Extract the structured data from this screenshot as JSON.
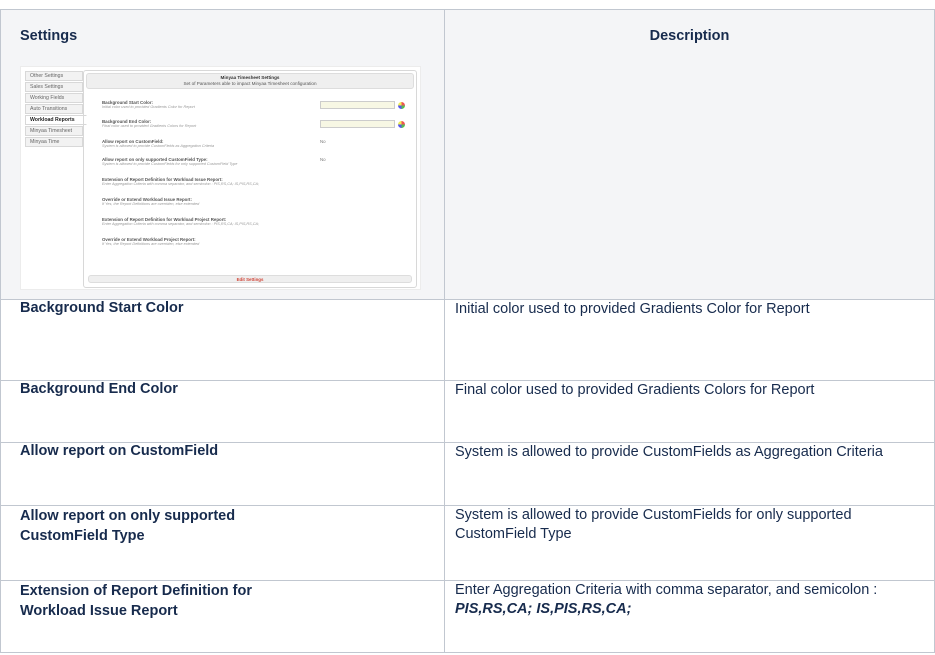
{
  "table": {
    "headers": {
      "settings": "Settings",
      "description": "Description"
    },
    "thumbnail": {
      "tabs": [
        "Other Settings",
        "Sales Settings",
        "Working Fields",
        "Auto Transitions",
        "Workload Reports",
        "Minyaa Timesheet",
        "Minyaa Time"
      ],
      "active_tab_index": 4,
      "panel_title": "Minyaa Timesheet Settings",
      "panel_subtitle": "Set of Parameters able to impact Minyaa Timesheet configuration",
      "rows": [
        {
          "label": "Background Start Color:",
          "desc": "Initial color used to provided Gradients Color for Report",
          "kind": "color"
        },
        {
          "label": "Background End Color:",
          "desc": "Final color used to provided Gradients Colors for Report",
          "kind": "color"
        },
        {
          "label": "Allow report on CustomField:",
          "desc": "System is allowed to provide CustomFields as Aggregation Criteria",
          "value": "No"
        },
        {
          "label": "Allow report on only supported CustomField Type:",
          "desc": "System is allowed to provide CustomFields for only supported CustomField Type",
          "value": "No"
        },
        {
          "label": "Extension of Report Definition for Workload Issue Report:",
          "desc": "Enter Aggregation Criteria with comma separator, and semicolon : PIS,RS,CA; IS,PIS,RS,CA;"
        },
        {
          "label": "Override or Extend Workload Issue Report:",
          "desc": "If Yes, the Report Definitions are overriden, else extended"
        },
        {
          "label": "Extension of Report Definition for Workload Project Report:",
          "desc": "Enter Aggregation Criteria with comma separator, and semicolon : PIS,RS,CA; IS,PIS,RS,CA;"
        },
        {
          "label": "Override or Extend Workload Project Report:",
          "desc": "If Yes, the Report Definitions are overriden, else extended"
        }
      ],
      "edit_button": "Edit Settings"
    },
    "rows": [
      {
        "name": "Background Start Color",
        "desc": "Initial color used to provided Gradients Color for Report"
      },
      {
        "name": "Background End Color",
        "desc": "Final color used to provided Gradients Colors for Report"
      },
      {
        "name": "Allow report on CustomField",
        "desc": "System is allowed to provide CustomFields as Aggregation Criteria"
      },
      {
        "name_line1": "Allow report on only supported",
        "name_line2": "CustomField Type",
        "desc": "System is allowed to provide CustomFields for only supported CustomField Type"
      },
      {
        "name_line1": "Extension of Report Definition for",
        "name_line2": "Workload Issue Report",
        "desc_prefix": "Enter Aggregation Criteria with comma separator, and semicolon : ",
        "desc_emph": "PIS,RS,CA; IS,PIS,RS,CA;"
      }
    ]
  },
  "colors": {
    "header_bg": "#f4f5f7",
    "border": "#c1c7d0",
    "text": "#172b4d",
    "edit_button_text": "#d04437"
  }
}
